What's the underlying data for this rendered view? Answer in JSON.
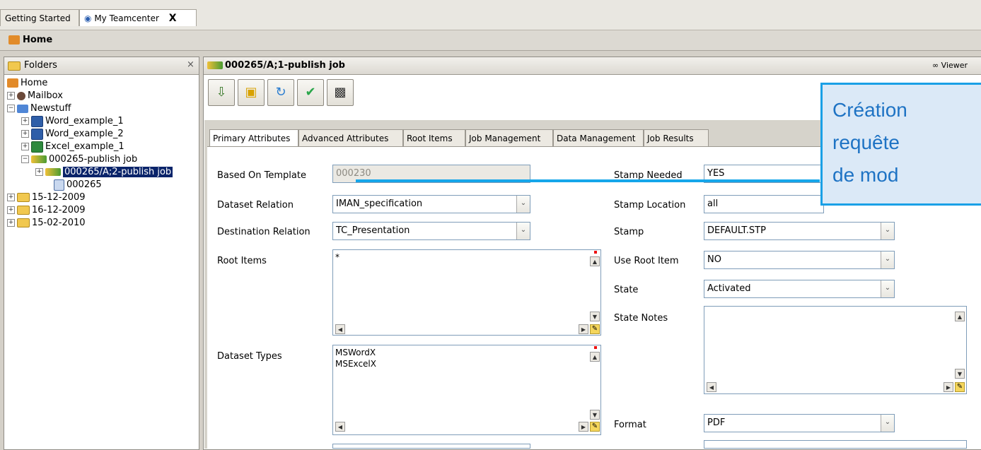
{
  "tabs": [
    {
      "label": "Getting Started"
    },
    {
      "label": "My Teamcenter",
      "close": "X"
    }
  ],
  "homebar": {
    "title": "Home"
  },
  "folders_panel": {
    "title": "Folders",
    "close": "×",
    "tree": [
      {
        "label": "Home"
      },
      {
        "label": "Mailbox"
      },
      {
        "label": "Newstuff"
      },
      {
        "label": "Word_example_1"
      },
      {
        "label": "Word_example_2"
      },
      {
        "label": "Excel_example_1"
      },
      {
        "label": "000265-publish job"
      },
      {
        "label": "000265/A;2-publish job"
      },
      {
        "label": "000265"
      },
      {
        "label": "15-12-2009"
      },
      {
        "label": "16-12-2009"
      },
      {
        "label": "15-02-2010"
      }
    ]
  },
  "main_panel": {
    "title": "000265/A;1-publish job",
    "viewer": "Viewer"
  },
  "form_tabs": [
    "Primary Attributes",
    "Advanced Attributes",
    "Root Items",
    "Job Management",
    "Data Management",
    "Job Results"
  ],
  "form": {
    "based_on_template_label": "Based On Template",
    "based_on_template_value": "000230",
    "dataset_relation_label": "Dataset Relation",
    "dataset_relation_value": "IMAN_specification",
    "destination_relation_label": "Destination Relation",
    "destination_relation_value": "TC_Presentation",
    "root_items_label": "Root Items",
    "root_items_value": "*",
    "dataset_types_label": "Dataset Types",
    "dataset_types_values": [
      "MSWordX",
      "MSExcelX"
    ],
    "stamp_needed_label": "Stamp Needed",
    "stamp_needed_value": "YES",
    "stamp_location_label": "Stamp Location",
    "stamp_location_value": "all",
    "stamp_label": "Stamp",
    "stamp_value": "DEFAULT.STP",
    "use_root_item_label": "Use Root Item",
    "use_root_item_value": "NO",
    "state_label": "State",
    "state_value": "Activated",
    "state_notes_label": "State Notes",
    "format_label": "Format",
    "format_value": "PDF"
  },
  "callout": {
    "lines": [
      "Création",
      "requête",
      "de mod"
    ],
    "color": "#1aa0e6"
  }
}
